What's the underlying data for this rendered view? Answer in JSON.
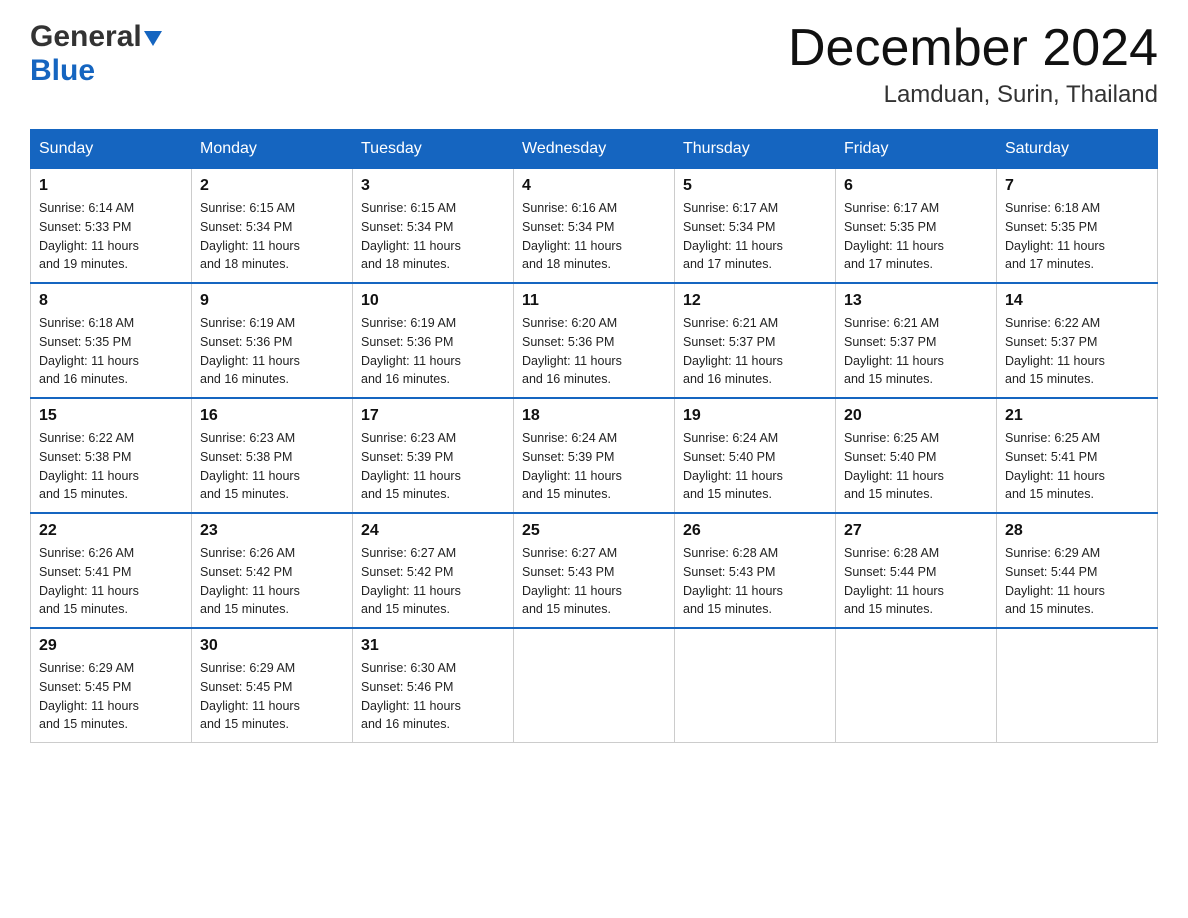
{
  "header": {
    "month_title": "December 2024",
    "location": "Lamduan, Surin, Thailand",
    "logo_general": "General",
    "logo_blue": "Blue"
  },
  "days_of_week": [
    "Sunday",
    "Monday",
    "Tuesday",
    "Wednesday",
    "Thursday",
    "Friday",
    "Saturday"
  ],
  "weeks": [
    [
      {
        "day": "1",
        "sunrise": "6:14 AM",
        "sunset": "5:33 PM",
        "daylight": "11 hours and 19 minutes."
      },
      {
        "day": "2",
        "sunrise": "6:15 AM",
        "sunset": "5:34 PM",
        "daylight": "11 hours and 18 minutes."
      },
      {
        "day": "3",
        "sunrise": "6:15 AM",
        "sunset": "5:34 PM",
        "daylight": "11 hours and 18 minutes."
      },
      {
        "day": "4",
        "sunrise": "6:16 AM",
        "sunset": "5:34 PM",
        "daylight": "11 hours and 18 minutes."
      },
      {
        "day": "5",
        "sunrise": "6:17 AM",
        "sunset": "5:34 PM",
        "daylight": "11 hours and 17 minutes."
      },
      {
        "day": "6",
        "sunrise": "6:17 AM",
        "sunset": "5:35 PM",
        "daylight": "11 hours and 17 minutes."
      },
      {
        "day": "7",
        "sunrise": "6:18 AM",
        "sunset": "5:35 PM",
        "daylight": "11 hours and 17 minutes."
      }
    ],
    [
      {
        "day": "8",
        "sunrise": "6:18 AM",
        "sunset": "5:35 PM",
        "daylight": "11 hours and 16 minutes."
      },
      {
        "day": "9",
        "sunrise": "6:19 AM",
        "sunset": "5:36 PM",
        "daylight": "11 hours and 16 minutes."
      },
      {
        "day": "10",
        "sunrise": "6:19 AM",
        "sunset": "5:36 PM",
        "daylight": "11 hours and 16 minutes."
      },
      {
        "day": "11",
        "sunrise": "6:20 AM",
        "sunset": "5:36 PM",
        "daylight": "11 hours and 16 minutes."
      },
      {
        "day": "12",
        "sunrise": "6:21 AM",
        "sunset": "5:37 PM",
        "daylight": "11 hours and 16 minutes."
      },
      {
        "day": "13",
        "sunrise": "6:21 AM",
        "sunset": "5:37 PM",
        "daylight": "11 hours and 15 minutes."
      },
      {
        "day": "14",
        "sunrise": "6:22 AM",
        "sunset": "5:37 PM",
        "daylight": "11 hours and 15 minutes."
      }
    ],
    [
      {
        "day": "15",
        "sunrise": "6:22 AM",
        "sunset": "5:38 PM",
        "daylight": "11 hours and 15 minutes."
      },
      {
        "day": "16",
        "sunrise": "6:23 AM",
        "sunset": "5:38 PM",
        "daylight": "11 hours and 15 minutes."
      },
      {
        "day": "17",
        "sunrise": "6:23 AM",
        "sunset": "5:39 PM",
        "daylight": "11 hours and 15 minutes."
      },
      {
        "day": "18",
        "sunrise": "6:24 AM",
        "sunset": "5:39 PM",
        "daylight": "11 hours and 15 minutes."
      },
      {
        "day": "19",
        "sunrise": "6:24 AM",
        "sunset": "5:40 PM",
        "daylight": "11 hours and 15 minutes."
      },
      {
        "day": "20",
        "sunrise": "6:25 AM",
        "sunset": "5:40 PM",
        "daylight": "11 hours and 15 minutes."
      },
      {
        "day": "21",
        "sunrise": "6:25 AM",
        "sunset": "5:41 PM",
        "daylight": "11 hours and 15 minutes."
      }
    ],
    [
      {
        "day": "22",
        "sunrise": "6:26 AM",
        "sunset": "5:41 PM",
        "daylight": "11 hours and 15 minutes."
      },
      {
        "day": "23",
        "sunrise": "6:26 AM",
        "sunset": "5:42 PM",
        "daylight": "11 hours and 15 minutes."
      },
      {
        "day": "24",
        "sunrise": "6:27 AM",
        "sunset": "5:42 PM",
        "daylight": "11 hours and 15 minutes."
      },
      {
        "day": "25",
        "sunrise": "6:27 AM",
        "sunset": "5:43 PM",
        "daylight": "11 hours and 15 minutes."
      },
      {
        "day": "26",
        "sunrise": "6:28 AM",
        "sunset": "5:43 PM",
        "daylight": "11 hours and 15 minutes."
      },
      {
        "day": "27",
        "sunrise": "6:28 AM",
        "sunset": "5:44 PM",
        "daylight": "11 hours and 15 minutes."
      },
      {
        "day": "28",
        "sunrise": "6:29 AM",
        "sunset": "5:44 PM",
        "daylight": "11 hours and 15 minutes."
      }
    ],
    [
      {
        "day": "29",
        "sunrise": "6:29 AM",
        "sunset": "5:45 PM",
        "daylight": "11 hours and 15 minutes."
      },
      {
        "day": "30",
        "sunrise": "6:29 AM",
        "sunset": "5:45 PM",
        "daylight": "11 hours and 15 minutes."
      },
      {
        "day": "31",
        "sunrise": "6:30 AM",
        "sunset": "5:46 PM",
        "daylight": "11 hours and 16 minutes."
      },
      null,
      null,
      null,
      null
    ]
  ],
  "labels": {
    "sunrise": "Sunrise:",
    "sunset": "Sunset:",
    "daylight": "Daylight:"
  }
}
